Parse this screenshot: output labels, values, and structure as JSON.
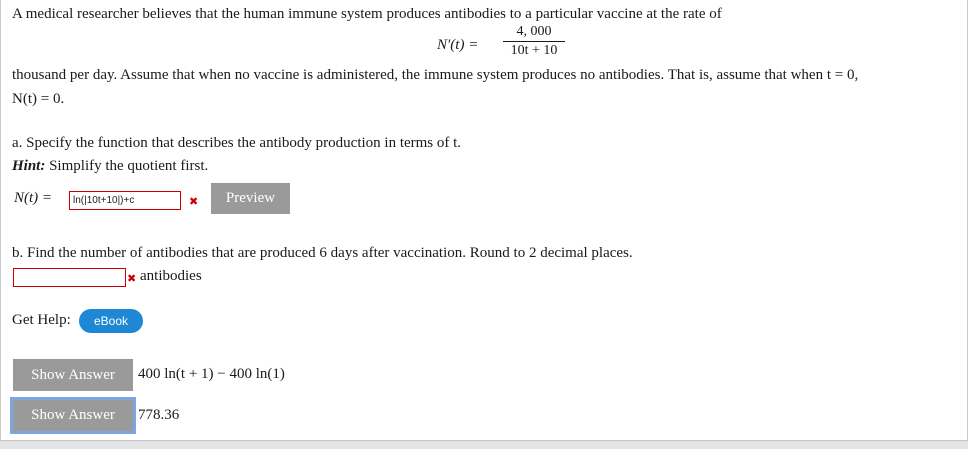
{
  "problem": {
    "intro": "A medical researcher believes that the human immune system produces antibodies to a particular vaccine at the rate of",
    "rate_lhs": "N′(t) =",
    "rate_numerator": "4, 000",
    "rate_denominator": "10t + 10",
    "line2": "thousand per day. Assume that when no vaccine is administered, the immune system produces no antibodies. That is, assume that when t = 0,",
    "line3": "N(t) = 0."
  },
  "part_a": {
    "prompt": "a. Specify the function that describes the antibody production in terms of t.",
    "hint_label": "Hint:",
    "hint_text": " Simplify the quotient first.",
    "input_label": "N(t) =",
    "input_value": "ln(|10t+10|)+c",
    "preview_label": "Preview"
  },
  "part_b": {
    "prompt": "b. Find the number of antibodies that are produced 6 days after vaccination. Round to 2 decimal places.",
    "input_value": "",
    "unit": "antibodies"
  },
  "help": {
    "label": "Get Help:",
    "ebook_label": "eBook"
  },
  "answers": [
    {
      "button_label": "Show Answer",
      "value": "400 ln(t + 1) − 400 ln(1)"
    },
    {
      "button_label": "Show Answer",
      "value": "778.36"
    }
  ],
  "colors": {
    "error": "#cc0000",
    "button_gray": "#9a9a9a",
    "ebook_blue": "#1e88d6",
    "focus_ring": "#7da6e0"
  },
  "icons": {
    "error_mark": "x-mark-icon"
  }
}
